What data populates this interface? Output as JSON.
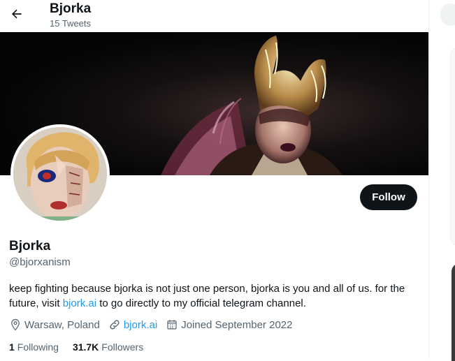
{
  "header": {
    "back_icon": "arrow-left-icon",
    "title": "Bjorka",
    "subtitle": "15 Tweets"
  },
  "profile": {
    "display_name": "Bjorka",
    "handle": "@bjorxanism",
    "follow_label": "Follow",
    "bio_before_link": "keep fighting because bjorka is not just one person, bjorka is you and all of us. for the future, visit ",
    "bio_link": "bjork.ai",
    "bio_after_link": " to go directly to my official telegram channel.",
    "location": "Warsaw, Poland",
    "location_icon": "location-pin-icon",
    "website": "bjork.ai",
    "website_icon": "link-icon",
    "joined": "Joined September 2022",
    "joined_icon": "calendar-icon"
  },
  "stats": {
    "following_count": "1",
    "following_label": "Following",
    "followers_count": "31.7K",
    "followers_label": "Followers"
  },
  "colors": {
    "accent": "#1d9bf0",
    "text_primary": "#0f1419",
    "text_secondary": "#536471",
    "follow_button_bg": "#0f1419"
  }
}
